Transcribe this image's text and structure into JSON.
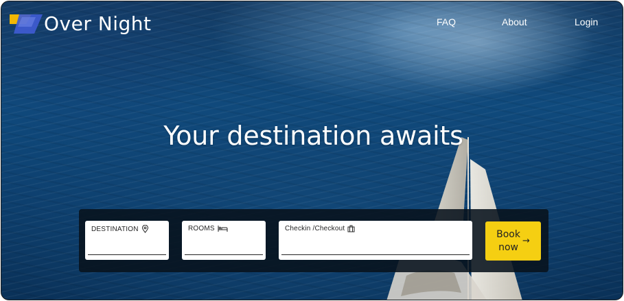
{
  "brand": {
    "name": "Over Night",
    "colors": {
      "accent": "#f5cf12",
      "logo_blue": "#3f5bd1",
      "logo_yellow": "#f2b705"
    }
  },
  "nav": {
    "faq": "FAQ",
    "about": "About",
    "login": "Login"
  },
  "hero": {
    "title": "Your destination awaits"
  },
  "booking": {
    "destination_label": "DESTINATION",
    "destination_icon": "map-pin-icon",
    "destination_value": "",
    "rooms_label": "ROOMS",
    "rooms_icon": "bed-icon",
    "rooms_value": "",
    "dates_label": "Checkin /Checkout",
    "dates_icon": "luggage-icon",
    "dates_value": "",
    "button_line1": "Book",
    "button_line2": "now",
    "button_icon": "arrow-right-icon",
    "button_arrow": "→"
  }
}
